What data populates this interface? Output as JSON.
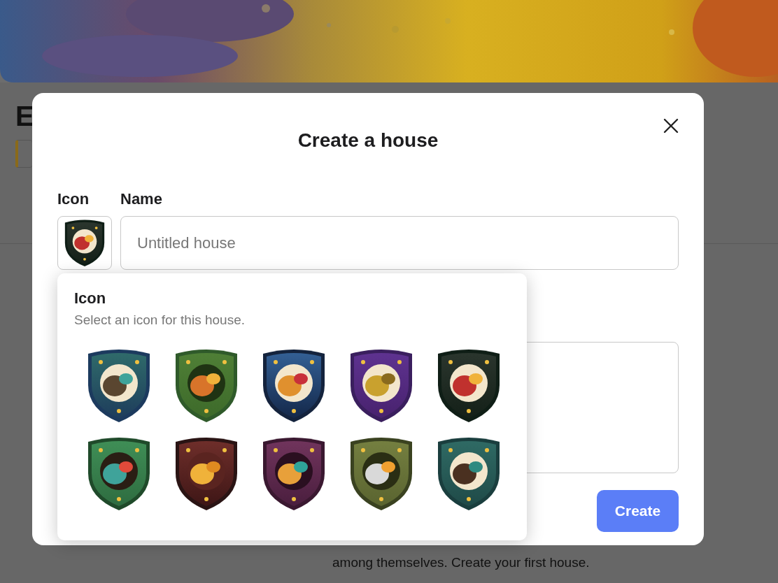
{
  "page": {
    "heading": "E",
    "empty_text": "among themselves. Create your first house."
  },
  "dialog": {
    "title": "Create a house",
    "icon_label": "Icon",
    "name_label": "Name",
    "name_field": {
      "placeholder": "Untitled house"
    },
    "create_button": "Create"
  },
  "icon_picker": {
    "title": "Icon",
    "hint": "Select an icon for this house."
  }
}
